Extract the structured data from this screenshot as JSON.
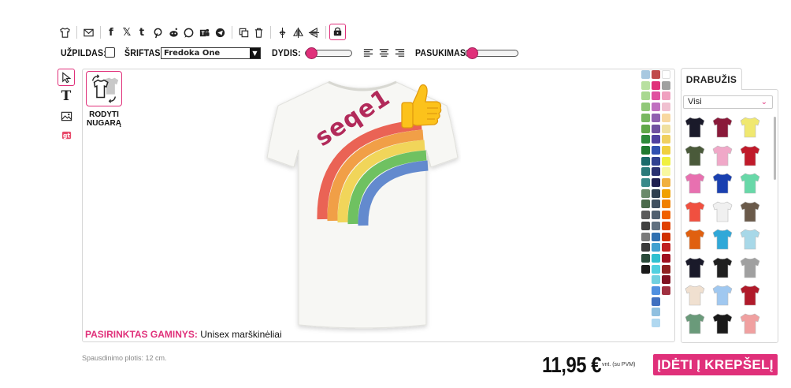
{
  "toolbar": {
    "fill_label": "UŽPILDAS:",
    "font_label": "ŠRIFTAS:",
    "font_value": "Fredoka One",
    "size_label": "DYDIS:",
    "rotation_label": "PASUKIMAS:",
    "size_level": 0.05,
    "rotation_level": 0.05
  },
  "canvas": {
    "back_label_line1": "RODYTI",
    "back_label_line2": "NUGARĄ",
    "design_text": "seqe1",
    "selected_label": "PASIRINKTAS GAMINYS:",
    "selected_value": "Unisex marškinėliai"
  },
  "palette": {
    "col1": [
      "#a8c8e0",
      "#b8e0a0",
      "#a8d890",
      "#90c878",
      "#78b860",
      "#60a848",
      "#2e8b3a",
      "#1f7a2f",
      "#1a6a6a",
      "#2a7a7a",
      "#3a8a8a",
      "#6a8a6a",
      "#4a6a4a",
      "#5a5a5a",
      "#404040",
      "#7a7a7a",
      "#3a3a3a",
      "#2a4a3a",
      "#1a1a1a"
    ],
    "col2": [
      "#c04a4a",
      "#e0307a",
      "#e050a0",
      "#c070c0",
      "#9060b0",
      "#7050a0",
      "#5040a0",
      "#3050b0",
      "#304090",
      "#2a3070",
      "#202050",
      "#304050",
      "#405060",
      "#506070",
      "#607080",
      "#3070b0",
      "#40a0d0",
      "#30c0d0",
      "#50d0e0",
      "#70d0e0",
      "#5090e0",
      "#4070c0",
      "#90c0e0",
      "#b0d8f0"
    ],
    "col3": [
      "#ffffff",
      "#a0a0a0",
      "#f0a0c0",
      "#f0c0d0",
      "#f8d8a0",
      "#f0e0a0",
      "#f0d060",
      "#f0d040",
      "#f0f040",
      "#f8f8a0",
      "#f0b040",
      "#f0a000",
      "#f08000",
      "#f06000",
      "#e04000",
      "#d03000",
      "#c02020",
      "#a01020",
      "#902020",
      "#801020",
      "#a03040"
    ]
  },
  "panel": {
    "tab_label": "DRABUŽIS",
    "filter_value": "Visi",
    "garments": [
      "#1a1a2a",
      "#8a1a3a",
      "#f0e870",
      "#4a5a3a",
      "#f0a8c8",
      "#c01a2a",
      "#e870b0",
      "#1a40b0",
      "#68d8a8",
      "#f05040",
      "#f0f0f0",
      "#6a5a4a",
      "#e06010",
      "#30a8d8",
      "#a8d8e8",
      "#1a1a2a",
      "#202020",
      "#a0a0a0",
      "#f0e0d0",
      "#a0c8f0",
      "#b01a2a",
      "#6a9a7a",
      "#1a1a1a",
      "#f0a0a0"
    ]
  },
  "footer": {
    "print_width": "Spausdinimo plotis: 12 cm.",
    "price": "11,95 €",
    "vat": "vnt. (su PVM)",
    "cart_label": "ĮDĖTI Į KREPŠELĮ"
  },
  "colors": {
    "accent": "#e0307a"
  },
  "icons": [
    "tshirt-icon",
    "image-icon",
    "facebook-icon",
    "x-icon",
    "tumblr-icon",
    "pinterest-icon",
    "reddit-icon",
    "whatsapp-icon",
    "teams-icon",
    "telegram-icon",
    "copy-icon",
    "trash-icon",
    "center-icon",
    "flip-horizontal-icon",
    "flip-vertical-icon",
    "lock-layer-icon",
    "cursor-icon",
    "text-icon",
    "image-upload-icon",
    "sticker-icon",
    "thumbs-up-emoji"
  ]
}
